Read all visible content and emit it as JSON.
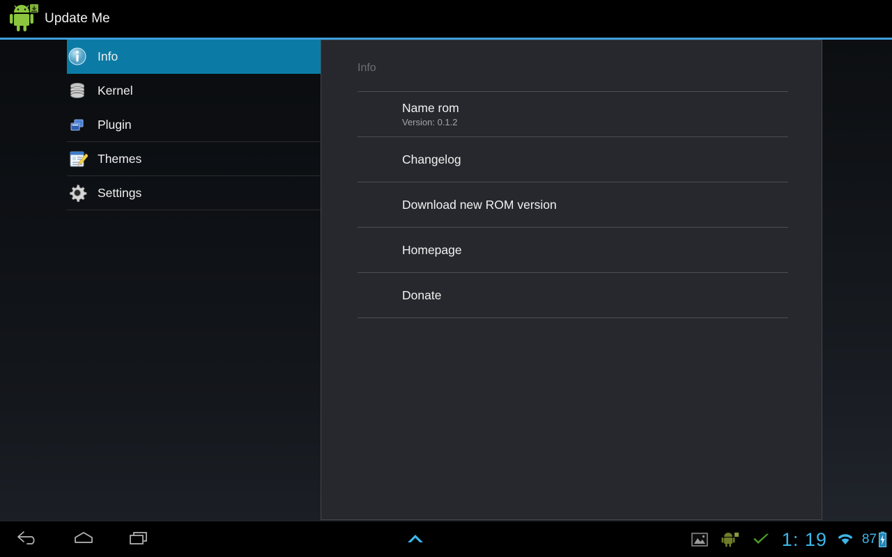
{
  "titlebar": {
    "app_icon": "android-download-icon",
    "title": "Update Me",
    "accent_line_color": "#3da0dd"
  },
  "sidebar": {
    "selected_color": "#0b7ba5",
    "items": [
      {
        "label": "Info",
        "icon": "info-icon",
        "selected": true
      },
      {
        "label": "Kernel",
        "icon": "database-icon",
        "selected": false
      },
      {
        "label": "Plugin",
        "icon": "windows-icon",
        "selected": false
      },
      {
        "label": "Themes",
        "icon": "notepad-pencil-icon",
        "selected": false
      },
      {
        "label": "Settings",
        "icon": "gear-icon",
        "selected": false
      }
    ]
  },
  "panel": {
    "header": "Info",
    "rows": [
      {
        "title": "Name rom",
        "subtitle": "Version: 0.1.2"
      },
      {
        "title": "Changelog",
        "subtitle": ""
      },
      {
        "title": "Download new ROM version",
        "subtitle": ""
      },
      {
        "title": "Homepage",
        "subtitle": ""
      },
      {
        "title": "Donate",
        "subtitle": ""
      }
    ]
  },
  "system_bar": {
    "nav": [
      {
        "name": "back",
        "icon": "back-arrow-icon"
      },
      {
        "name": "home",
        "icon": "home-icon"
      },
      {
        "name": "recents",
        "icon": "recent-apps-icon"
      },
      {
        "name": "up",
        "icon": "chevron-up-icon"
      }
    ],
    "notifications": [
      {
        "icon": "screenshot-image-icon"
      },
      {
        "icon": "android-update-icon"
      },
      {
        "icon": "green-check-icon"
      }
    ],
    "clock": "1: 19",
    "wifi_icon": "wifi-icon",
    "battery_percent": "87",
    "battery_icon": "battery-charging-icon",
    "accent_color": "#3cb7e8"
  }
}
